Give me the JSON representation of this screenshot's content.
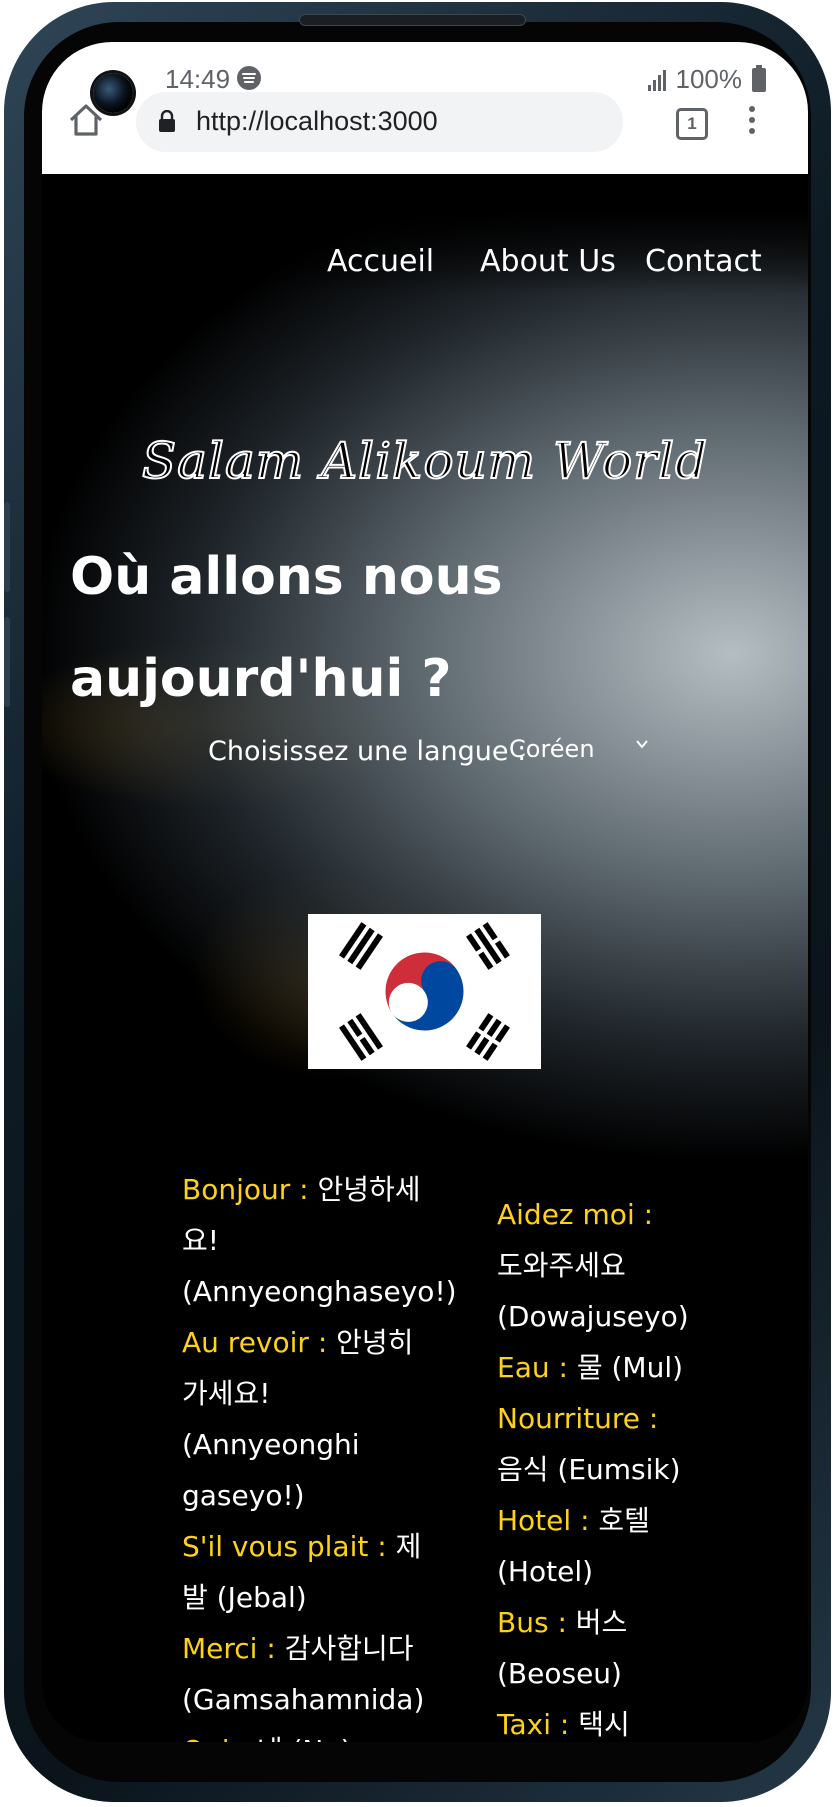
{
  "status_bar": {
    "time": "14:49",
    "battery": "100%"
  },
  "browser": {
    "url": "http://localhost:3000",
    "tab_count": "1"
  },
  "nav": {
    "items": [
      "Accueil",
      "About Us",
      "Contact"
    ]
  },
  "logo": "Salam Alikoum World",
  "headline": "Où allons nous aujourd'hui ?",
  "language": {
    "label": "Choisissez une langue :",
    "selected": "Coréen"
  },
  "flag": {
    "country": "South Korea",
    "red": "#cd2e3a",
    "blue": "#0047a0"
  },
  "phrases_left": [
    {
      "fr": "Bonjour :",
      "kr": "안녕하세요! (Annyeonghaseyo!)"
    },
    {
      "fr": "Au revoir :",
      "kr": "안녕히 가세요! (Annyeonghi gaseyo!)"
    },
    {
      "fr": "S'il vous plait :",
      "kr": "제발 (Jebal)"
    },
    {
      "fr": "Merci :",
      "kr": "감사합니다 (Gamsahamnida)"
    },
    {
      "fr": "Oui :",
      "kr": "네 (Ne)"
    }
  ],
  "phrases_right": [
    {
      "fr": "Aidez moi :",
      "kr": "도와주세요 (Dowajuseyo)"
    },
    {
      "fr": "Eau :",
      "kr": "물 (Mul)"
    },
    {
      "fr": "Nourriture :",
      "kr": "음식 (Eumsik)"
    },
    {
      "fr": "Hotel :",
      "kr": "호텔 (Hotel)"
    },
    {
      "fr": "Bus :",
      "kr": "버스 (Beoseu)"
    },
    {
      "fr": "Taxi :",
      "kr": "택시 (Taegsi)"
    }
  ],
  "colors": {
    "accent_yellow": "#ffd21a",
    "text": "#ffffff",
    "background": "#000000"
  }
}
